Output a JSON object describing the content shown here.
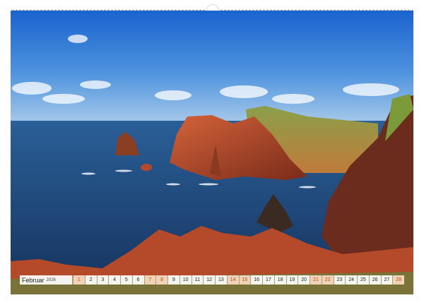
{
  "calendar": {
    "month": "Februar",
    "year": "2026",
    "days": [
      {
        "label": "1",
        "weekend": true
      },
      {
        "label": "2",
        "weekend": false
      },
      {
        "label": "3",
        "weekend": false
      },
      {
        "label": "4",
        "weekend": false
      },
      {
        "label": "5",
        "weekend": false
      },
      {
        "label": "6",
        "weekend": false
      },
      {
        "label": "7",
        "weekend": true
      },
      {
        "label": "8",
        "weekend": true
      },
      {
        "label": "9",
        "weekend": false
      },
      {
        "label": "10",
        "weekend": false
      },
      {
        "label": "11",
        "weekend": false
      },
      {
        "label": "12",
        "weekend": false
      },
      {
        "label": "13",
        "weekend": false
      },
      {
        "label": "14",
        "weekend": true
      },
      {
        "label": "15",
        "weekend": true
      },
      {
        "label": "16",
        "weekend": false
      },
      {
        "label": "17",
        "weekend": false
      },
      {
        "label": "18",
        "weekend": false
      },
      {
        "label": "19",
        "weekend": false
      },
      {
        "label": "20",
        "weekend": false
      },
      {
        "label": "21",
        "weekend": true
      },
      {
        "label": "22",
        "weekend": true
      },
      {
        "label": "23",
        "weekend": false
      },
      {
        "label": "24",
        "weekend": false
      },
      {
        "label": "25",
        "weekend": false
      },
      {
        "label": "26",
        "weekend": false
      },
      {
        "label": "27",
        "weekend": false
      },
      {
        "label": "28",
        "weekend": true
      }
    ]
  },
  "colors": {
    "weekend_bg": "#f6d6bc",
    "weekend_text": "#b14a1f",
    "sky_top": "#1f6fd6",
    "sea": "#1b3f73",
    "cliff": "#b8482a"
  }
}
